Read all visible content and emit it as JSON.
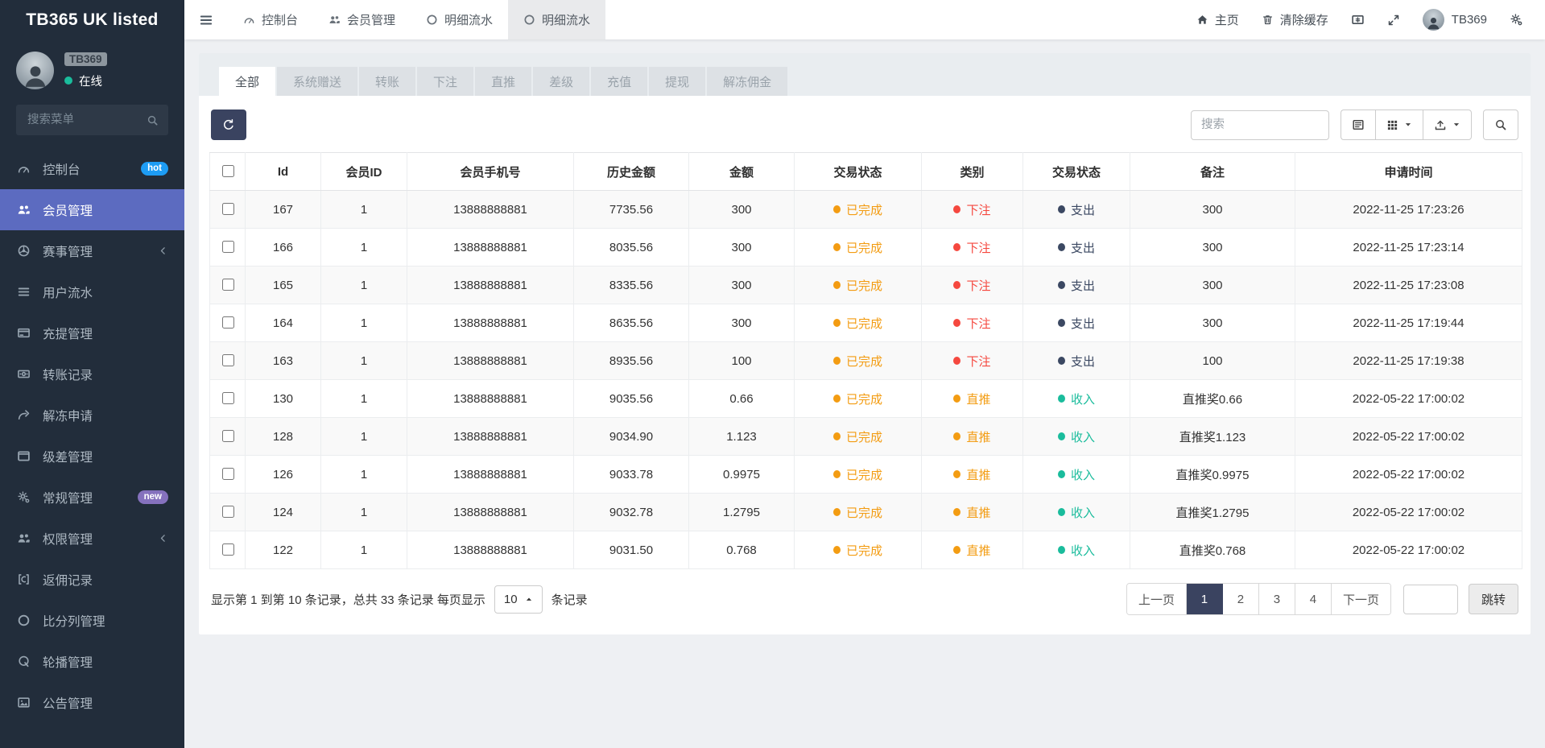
{
  "colors": {
    "sidebar_bg": "#222d3b",
    "content_bg": "#eef0f3",
    "active_menu": "#5c6bc0",
    "hot_badge": "#1d9cf4",
    "new_badge": "#8571bd",
    "online_dot": "#1abc9c",
    "status_done": "#f39c12",
    "category_bet": "#f5483f",
    "category_direct": "#f39c12",
    "flow_expense": "#3b4862",
    "flow_income": "#1abc9c",
    "dark_button": "#3a4360"
  },
  "sidebar": {
    "title": "TB365 UK listed",
    "user": {
      "name": "TB369",
      "status": "在线"
    },
    "search_placeholder": "搜索菜单",
    "items": [
      {
        "key": "dashboard",
        "label": "控制台",
        "icon": "dashboard-icon",
        "badge": "hot"
      },
      {
        "key": "members",
        "label": "会员管理",
        "icon": "users-icon",
        "active": true
      },
      {
        "key": "matches",
        "label": "赛事管理",
        "icon": "ball-icon",
        "chevron": true
      },
      {
        "key": "user-flow",
        "label": "用户流水",
        "icon": "list-icon"
      },
      {
        "key": "recharge-withdraw",
        "label": "充提管理",
        "icon": "card-icon"
      },
      {
        "key": "transfer-records",
        "label": "转账记录",
        "icon": "money-icon"
      },
      {
        "key": "unfreeze-requests",
        "label": "解冻申请",
        "icon": "redo-icon"
      },
      {
        "key": "level-diff",
        "label": "级差管理",
        "icon": "window-icon"
      },
      {
        "key": "general",
        "label": "常规管理",
        "icon": "cogs-icon",
        "badge": "new"
      },
      {
        "key": "permissions",
        "label": "权限管理",
        "icon": "users-icon",
        "chevron": true
      },
      {
        "key": "commission-records",
        "label": "返佣记录",
        "icon": "commission-icon"
      },
      {
        "key": "score-columns",
        "label": "比分列管理",
        "icon": "circle-icon"
      },
      {
        "key": "carousel",
        "label": "轮播管理",
        "icon": "loop-icon"
      },
      {
        "key": "announcements",
        "label": "公告管理",
        "icon": "image-icon"
      }
    ]
  },
  "navbar": {
    "tabs": [
      {
        "key": "dashboard",
        "label": "控制台",
        "icon": "dashboard-icon"
      },
      {
        "key": "members",
        "label": "会员管理",
        "icon": "users-icon"
      },
      {
        "key": "flow-1",
        "label": "明细流水",
        "icon": "circle-icon"
      },
      {
        "key": "flow-2",
        "label": "明细流水",
        "icon": "circle-icon",
        "active": true
      }
    ],
    "right": {
      "home": "主页",
      "clear_cache": "清除缓存",
      "username": "TB369"
    }
  },
  "filter_tabs": {
    "active_index": 0,
    "items": [
      "全部",
      "系统赠送",
      "转账",
      "下注",
      "直推",
      "差级",
      "充值",
      "提现",
      "解冻佣金"
    ]
  },
  "toolbar": {
    "search_placeholder": "搜索"
  },
  "table": {
    "columns": [
      "Id",
      "会员ID",
      "会员手机号",
      "历史金额",
      "金额",
      "交易状态",
      "类别",
      "交易状态",
      "备注",
      "申请时间"
    ],
    "rows": [
      {
        "id": "167",
        "member_id": "1",
        "phone": "13888888881",
        "history_amount": "7735.56",
        "amount": "300",
        "trade_status": "已完成",
        "category": "下注",
        "category_color": "red",
        "flow": "支出",
        "flow_color": "navy",
        "remark": "300",
        "time": "2022-11-25 17:23:26"
      },
      {
        "id": "166",
        "member_id": "1",
        "phone": "13888888881",
        "history_amount": "8035.56",
        "amount": "300",
        "trade_status": "已完成",
        "category": "下注",
        "category_color": "red",
        "flow": "支出",
        "flow_color": "navy",
        "remark": "300",
        "time": "2022-11-25 17:23:14"
      },
      {
        "id": "165",
        "member_id": "1",
        "phone": "13888888881",
        "history_amount": "8335.56",
        "amount": "300",
        "trade_status": "已完成",
        "category": "下注",
        "category_color": "red",
        "flow": "支出",
        "flow_color": "navy",
        "remark": "300",
        "time": "2022-11-25 17:23:08"
      },
      {
        "id": "164",
        "member_id": "1",
        "phone": "13888888881",
        "history_amount": "8635.56",
        "amount": "300",
        "trade_status": "已完成",
        "category": "下注",
        "category_color": "red",
        "flow": "支出",
        "flow_color": "navy",
        "remark": "300",
        "time": "2022-11-25 17:19:44"
      },
      {
        "id": "163",
        "member_id": "1",
        "phone": "13888888881",
        "history_amount": "8935.56",
        "amount": "100",
        "trade_status": "已完成",
        "category": "下注",
        "category_color": "red",
        "flow": "支出",
        "flow_color": "navy",
        "remark": "100",
        "time": "2022-11-25 17:19:38"
      },
      {
        "id": "130",
        "member_id": "1",
        "phone": "13888888881",
        "history_amount": "9035.56",
        "amount": "0.66",
        "trade_status": "已完成",
        "category": "直推",
        "category_color": "orange",
        "flow": "收入",
        "flow_color": "teal",
        "remark": "直推奖0.66",
        "time": "2022-05-22 17:00:02"
      },
      {
        "id": "128",
        "member_id": "1",
        "phone": "13888888881",
        "history_amount": "9034.90",
        "amount": "1.123",
        "trade_status": "已完成",
        "category": "直推",
        "category_color": "orange",
        "flow": "收入",
        "flow_color": "teal",
        "remark": "直推奖1.123",
        "time": "2022-05-22 17:00:02"
      },
      {
        "id": "126",
        "member_id": "1",
        "phone": "13888888881",
        "history_amount": "9033.78",
        "amount": "0.9975",
        "trade_status": "已完成",
        "category": "直推",
        "category_color": "orange",
        "flow": "收入",
        "flow_color": "teal",
        "remark": "直推奖0.9975",
        "time": "2022-05-22 17:00:02"
      },
      {
        "id": "124",
        "member_id": "1",
        "phone": "13888888881",
        "history_amount": "9032.78",
        "amount": "1.2795",
        "trade_status": "已完成",
        "category": "直推",
        "category_color": "orange",
        "flow": "收入",
        "flow_color": "teal",
        "remark": "直推奖1.2795",
        "time": "2022-05-22 17:00:02"
      },
      {
        "id": "122",
        "member_id": "1",
        "phone": "13888888881",
        "history_amount": "9031.50",
        "amount": "0.768",
        "trade_status": "已完成",
        "category": "直推",
        "category_color": "orange",
        "flow": "收入",
        "flow_color": "teal",
        "remark": "直推奖0.768",
        "time": "2022-05-22 17:00:02"
      }
    ]
  },
  "pagination": {
    "summary_prefix": "显示第 1 到第 10 条记录，总共 33 条记录 每页显示",
    "page_size": "10",
    "summary_suffix": "条记录",
    "prev_label": "上一页",
    "next_label": "下一页",
    "pages": [
      "1",
      "2",
      "3",
      "4"
    ],
    "active_page": "1",
    "jump_label": "跳转"
  }
}
